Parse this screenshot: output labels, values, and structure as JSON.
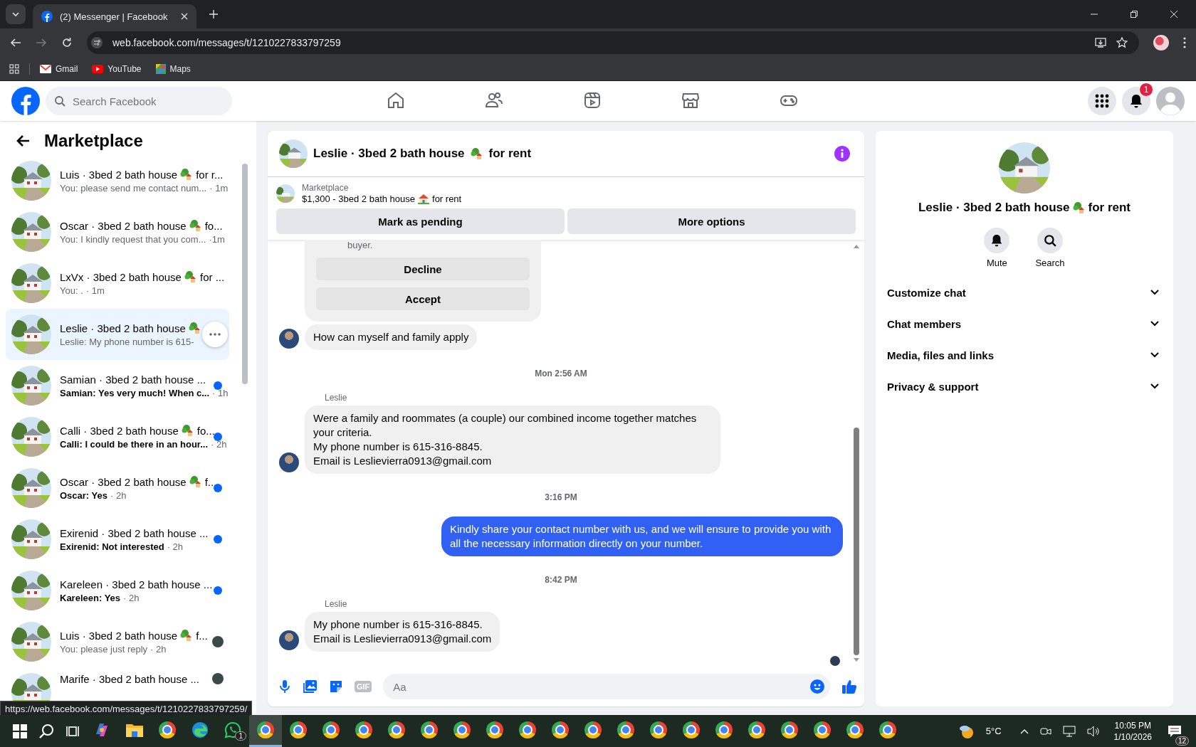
{
  "browser": {
    "tab_title": "(2) Messenger | Facebook",
    "url": "web.facebook.com/messages/t/1210227833797259",
    "bookmarks": [
      {
        "label": "Gmail",
        "kind": "mail"
      },
      {
        "label": "YouTube",
        "kind": "video"
      },
      {
        "label": "Maps",
        "kind": "map"
      }
    ]
  },
  "header": {
    "search_placeholder": "Search Facebook",
    "notification_count": "1",
    "nav": [
      {
        "kind": "home",
        "selected": false
      },
      {
        "kind": "friends",
        "selected": false
      },
      {
        "kind": "video",
        "selected": false
      },
      {
        "kind": "market",
        "selected": false
      },
      {
        "kind": "gaming",
        "selected": false
      }
    ]
  },
  "sidebar": {
    "title": "Marketplace",
    "conversations": [
      {
        "title": "Luis · 3bed 2 bath house",
        "emoji": true,
        "title_end": "for r...",
        "preview": "You: please send me contact num...",
        "time": "· 1m",
        "unread": false,
        "selected": false,
        "hovered": false,
        "seen": false
      },
      {
        "title": "Oscar · 3bed 2 bath house",
        "emoji": true,
        "title_end": "fo...",
        "preview": "You: I kindly request that you com...",
        "time": "·1m",
        "unread": false,
        "selected": false,
        "hovered": false,
        "seen": false
      },
      {
        "title": "LxVx · 3bed 2 bath house",
        "emoji": true,
        "title_end": "for ...",
        "preview": "You: .",
        "time": "· 1m",
        "unread": false,
        "selected": false,
        "hovered": false,
        "seen": false
      },
      {
        "title": "Leslie · 3bed 2 bath house",
        "emoji": true,
        "preview": "Leslie: My phone number is 615-",
        "unread": false,
        "selected": true,
        "hovered": true,
        "seen": false
      },
      {
        "title": "Samian · 3bed 2 bath house ...",
        "emoji": false,
        "preview": "Samian: Yes very much! When c...",
        "time": "· 1h",
        "unread": true,
        "selected": false,
        "hovered": false,
        "seen": false
      },
      {
        "title": "Calli · 3bed 2 bath house",
        "emoji": true,
        "title_end": "fo...",
        "preview": "Calli: I could be there in an hour...",
        "time": "· 2h",
        "unread": true,
        "selected": false,
        "hovered": false,
        "seen": false
      },
      {
        "title": "Oscar · 3bed 2 bath house",
        "emoji": true,
        "title_end": "f...",
        "preview": "Oscar: Yes",
        "time": "· 2h",
        "unread": true,
        "selected": false,
        "hovered": false,
        "seen": false
      },
      {
        "title": "Exirenid · 3bed 2 bath house ...",
        "emoji": false,
        "preview": "Exirenid: Not interested",
        "time": "· 2h",
        "unread": true,
        "selected": false,
        "hovered": false,
        "seen": false
      },
      {
        "title": "Kareleen · 3bed 2 bath house ...",
        "emoji": false,
        "preview": "Kareleen: Yes",
        "time": "· 2h",
        "unread": true,
        "selected": false,
        "hovered": false,
        "seen": false
      },
      {
        "title": "Luis · 3bed 2 bath house",
        "emoji": true,
        "title_end": "f...",
        "preview": "You: please just reply",
        "time": "· 2h",
        "unread": false,
        "selected": false,
        "hovered": false,
        "seen": true
      },
      {
        "title": "Marife · 3bed 2 bath house ...",
        "emoji": false,
        "unread": false,
        "selected": false,
        "hovered": false,
        "seen": true
      }
    ]
  },
  "status_url": "https://web.facebook.com/messages/t/1210227833797259/",
  "chat": {
    "title": "Leslie · 3bed 2 bath house",
    "title_end": "for rent",
    "listing": {
      "label": "Marketplace",
      "text": "$1,300 - 3bed 2 bath house",
      "text_end": "for rent"
    },
    "actions": [
      "Mark as pending",
      "More options"
    ],
    "messages": [
      {
        "kind": "card",
        "text": "buyer.",
        "buttons": [
          "Decline",
          "Accept"
        ]
      },
      {
        "kind": "incoming",
        "lines": [
          "How can myself and family apply"
        ],
        "avatar": true
      },
      {
        "kind": "time",
        "text": "Mon 2:56 AM"
      },
      {
        "kind": "sender",
        "text": "Leslie"
      },
      {
        "kind": "incoming",
        "lines": [
          "Were a family and roommates (a couple) our combined income together matches your criteria.",
          "My phone number is 615-316-8845.",
          "Email is Leslievierra0913@gmail.com"
        ],
        "avatar": true
      },
      {
        "kind": "time",
        "text": "3:16 PM"
      },
      {
        "kind": "outgoing",
        "lines": [
          "Kindly share your contact number with us, and we will ensure to provide you with all the necessary information directly on your number."
        ]
      },
      {
        "kind": "time",
        "text": "8:42 PM"
      },
      {
        "kind": "sender",
        "text": "Leslie"
      },
      {
        "kind": "incoming",
        "lines": [
          "My phone number is 615-316-8845.",
          "Email is Leslievierra0913@gmail.com"
        ],
        "avatar": true
      }
    ],
    "composer_placeholder": "Aa",
    "gif_label": "GIF"
  },
  "details": {
    "name": "Leslie · 3bed 2 bath house",
    "name_end": "for rent",
    "buttons": [
      {
        "label": "Mute",
        "kind": "bell"
      },
      {
        "label": "Search",
        "kind": "search"
      }
    ],
    "sections": [
      {
        "label": "Customize chat",
        "expanded": false
      },
      {
        "label": "Chat members",
        "expanded": false
      },
      {
        "label": "Media, files and links",
        "expanded": false
      },
      {
        "label": "Privacy & support",
        "expanded": false
      }
    ]
  },
  "taskbar": {
    "apps": [
      {
        "kind": "copilot",
        "active": false
      },
      {
        "kind": "folder",
        "active": false
      },
      {
        "kind": "browser",
        "active": false
      },
      {
        "kind": "edge",
        "active": false
      },
      {
        "kind": "chat",
        "active": false,
        "badge": "1"
      },
      {
        "kind": "browser",
        "active": true
      },
      {
        "kind": "browser",
        "active": false
      },
      {
        "kind": "browser",
        "active": false
      },
      {
        "kind": "browser",
        "active": false
      },
      {
        "kind": "browser",
        "active": false
      },
      {
        "kind": "browser",
        "active": false
      },
      {
        "kind": "browser",
        "active": false
      },
      {
        "kind": "browser",
        "active": false
      },
      {
        "kind": "browser",
        "active": false
      },
      {
        "kind": "browser",
        "active": false
      },
      {
        "kind": "browser",
        "active": false
      },
      {
        "kind": "browser",
        "active": false
      },
      {
        "kind": "browser",
        "active": false
      },
      {
        "kind": "browser",
        "active": false
      },
      {
        "kind": "browser",
        "active": false
      },
      {
        "kind": "browser",
        "active": false
      },
      {
        "kind": "browser",
        "active": false
      },
      {
        "kind": "browser",
        "active": false
      },
      {
        "kind": "browser",
        "active": false
      },
      {
        "kind": "browser",
        "active": false
      }
    ],
    "weather": "5°C",
    "time": "10:05 PM",
    "date": "1/10/2026",
    "notifications": "12"
  }
}
